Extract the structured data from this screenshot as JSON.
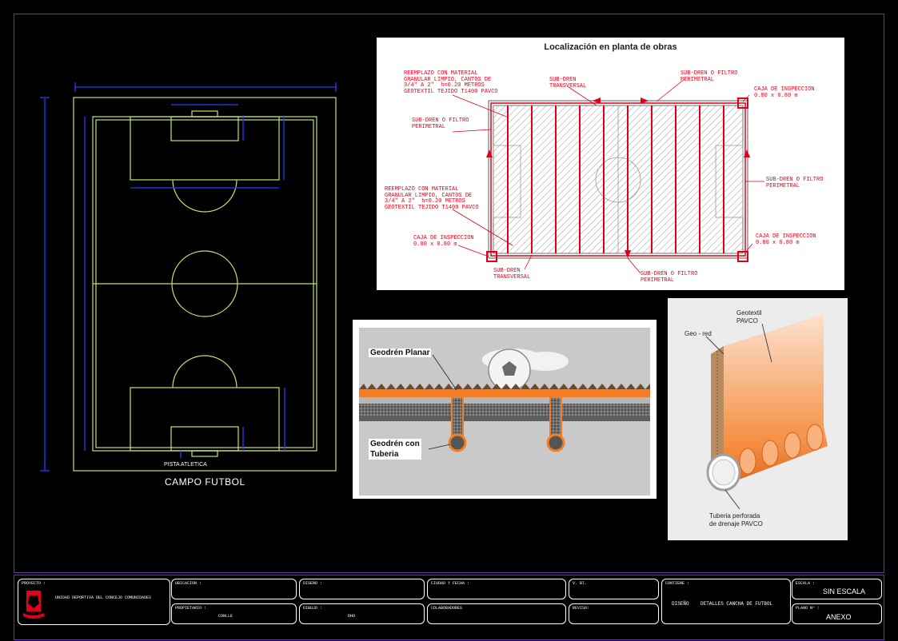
{
  "colors": {
    "background": "#000000",
    "frame": "#6b2fb4",
    "field_line": "#c6e36d",
    "dimension": "#2b38ff",
    "drain_red": "#e1001a",
    "white": "#ffffff",
    "orange": "#f57d24"
  },
  "field": {
    "caption": "CAMPO FUTBOL",
    "track_label": "PISTA ATLETICA"
  },
  "plan": {
    "title": "Localización en planta de obras",
    "notes": {
      "reemplazo_top": "REEMPLAZO CON MATERIAL\nGRANULAR LIMPIO, CANTOS DE\n3/4\" A 2\"  h=0.20 METROS\nGEOTEXTIL TEJIDO T1400 PAVCO",
      "reemplazo_mid": "REEMPLAZO CON MATERIAL\nGRANULAR LIMPIO, CANTOS DE\n3/4\" A 2\"  h=0.20 METROS\nGEOTEXTIL TEJIDO T1400 PAVCO",
      "subdren_transversal_top": "SUB-DREN\nTRANSVERSAL",
      "subdren_perimetral_top": "SUB-DREN O FILTRO\nPERIMETRAL",
      "caja_top_right": "CAJA DE INSPECCION\n0.80 x 0.80 m",
      "subdren_left": "SUB-DREN O FILTRO\nPERIMETRAL",
      "subdren_right": "SUB-DREN O FILTRO\nPERIMETRAL",
      "caja_bottom_left": "CAJA DE INSPECCION\n0.80 x 0.80 m",
      "caja_bottom_right": "CAJA DE INSPECCION\n0.80 x 0.80 m",
      "subdren_transversal_bottom": "SUB-DREN\nTRANSVERSAL",
      "subdren_perimetral_bottom": "SUB-DREN O FILTRO\nPERIMETRAL"
    }
  },
  "section": {
    "label_planar": "Geodrén Planar",
    "label_tuberia": "Geodrén con\nTuberia"
  },
  "product": {
    "label_geotextil": "Geotextil\nPAVCO",
    "label_geored": "Geo - red",
    "label_tuberia": "Tuberia perforada\nde drenaje PAVCO"
  },
  "title_block": {
    "proyecto_label": "PROYECTO :",
    "proyecto_value": "UNIDAD DEPORTIVA DEL CONCEJO COMUNIDADES",
    "ubicacion_label": "UBICACION :",
    "propietario_label": "PROPIETARIO :",
    "propietario_value": "CONLLE",
    "diseno_label": "DISEÑO :",
    "dibujo_label": "DIBUJO :",
    "dibujo_value": "DHO",
    "ciudad_label": "CIUDAD Y FECHA :",
    "colaboradores_label": "COLABORADORES",
    "vb_label": "V. Bl.",
    "reviso_label": "REVISO:",
    "contiene_label": "CONTIENE :",
    "contiene_value": "DISEÑO    DETALLES CANCHA DE FUTBOL",
    "escala_label": "ESCALA :",
    "escala_value": "SIN ESCALA",
    "plano_label": "PLANO   Nº :",
    "plano_value": "ANEXO"
  }
}
